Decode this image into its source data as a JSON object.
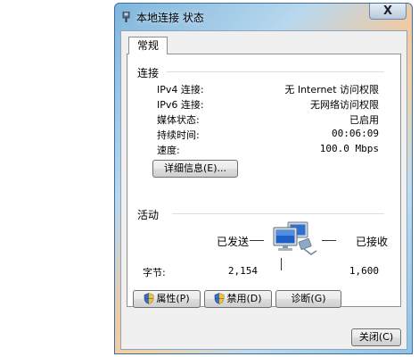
{
  "window": {
    "title": "本地连接 状态",
    "close_glyph": "X"
  },
  "tabs": [
    {
      "label": "常规"
    }
  ],
  "connection": {
    "heading": "连接",
    "rows": [
      {
        "label": "IPv4 连接:",
        "value": "无 Internet 访问权限"
      },
      {
        "label": "IPv6 连接:",
        "value": "无网络访问权限"
      },
      {
        "label": "媒体状态:",
        "value": "已启用"
      },
      {
        "label": "持续时间:",
        "value": "00:06:09"
      },
      {
        "label": "速度:",
        "value": "100.0 Mbps"
      }
    ],
    "details_button": "详细信息(E)..."
  },
  "activity": {
    "heading": "活动",
    "sent_label": "已发送",
    "received_label": "已接收",
    "bytes_label": "字节:",
    "bytes_sent": "2,154",
    "bytes_received": "1,600",
    "icon": "network-computers-icon"
  },
  "buttons": {
    "properties": "属性(P)",
    "disable": "禁用(D)",
    "diagnose": "诊断(G)",
    "close": "关闭(C)"
  },
  "colors": {
    "frame": "#3a6ea5",
    "group_line": "#d5dfe5",
    "client_bg": "#f0f0f0"
  }
}
